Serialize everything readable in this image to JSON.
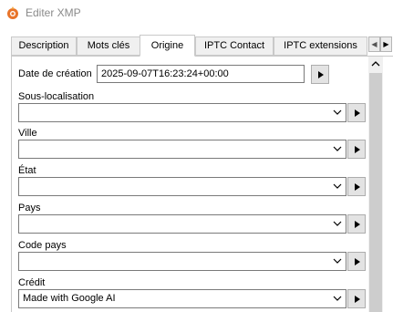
{
  "window": {
    "title": "Editer XMP",
    "icon": "gear-flame-icon"
  },
  "tabs": [
    {
      "label": "Description",
      "active": false
    },
    {
      "label": "Mots clés",
      "active": false
    },
    {
      "label": "Origine",
      "active": true
    },
    {
      "label": "IPTC Contact",
      "active": false
    },
    {
      "label": "IPTC extensions",
      "active": false
    }
  ],
  "tab_scroll": {
    "left_icon": "triangle-left-icon",
    "right_icon": "triangle-right-icon"
  },
  "fields": {
    "date_creation": {
      "label": "Date de création",
      "value": "2025-09-07T16:23:24+00:00"
    },
    "sous_localisation": {
      "label": "Sous-localisation",
      "value": ""
    },
    "ville": {
      "label": "Ville",
      "value": ""
    },
    "etat": {
      "label": "État",
      "value": ""
    },
    "pays": {
      "label": "Pays",
      "value": ""
    },
    "code_pays": {
      "label": "Code pays",
      "value": ""
    },
    "credit": {
      "label": "Crédit",
      "value": "Made with Google AI"
    }
  },
  "colors": {
    "title_text": "#8a8a8a",
    "border": "#7a7a7a",
    "button_bg": "#e3e3e3",
    "scroll_thumb": "#cdcdcd"
  }
}
